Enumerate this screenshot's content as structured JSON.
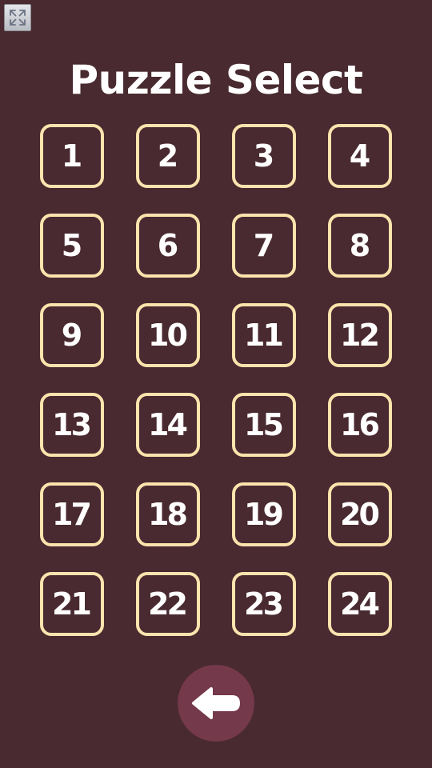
{
  "header": {
    "title": "Puzzle Select",
    "fullscreen_icon": "fullscreen-icon"
  },
  "levels": [
    "1",
    "2",
    "3",
    "4",
    "5",
    "6",
    "7",
    "8",
    "9",
    "10",
    "11",
    "12",
    "13",
    "14",
    "15",
    "16",
    "17",
    "18",
    "19",
    "20",
    "21",
    "22",
    "23",
    "24"
  ],
  "footer": {
    "back_icon": "arrow-left-icon"
  },
  "colors": {
    "background": "#482a30",
    "tile_border": "#fde3ad",
    "text": "#ffffff",
    "back_button": "#74394a"
  }
}
